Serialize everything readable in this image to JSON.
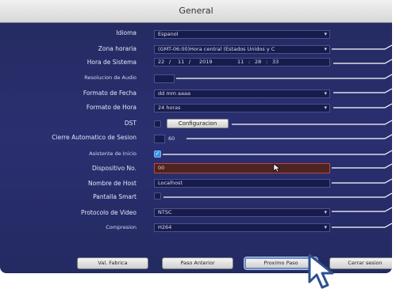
{
  "title": "General",
  "settings": [
    {
      "label": "Idioma",
      "value": "Espanol",
      "type": "dropdown"
    },
    {
      "label": "Zona horaria",
      "value": "(GMT-06:00)Hora central (Estados Unidos y C",
      "type": "dropdown"
    },
    {
      "label": "Hora de Sistema",
      "type": "datetime"
    },
    {
      "label": "Resolucion de Audio",
      "type": "small"
    },
    {
      "label": "Formato de Fecha",
      "value": "dd mm aaaa",
      "type": "dropdown"
    },
    {
      "label": "Formato de Hora",
      "value": "24 horas",
      "type": "dropdown"
    },
    {
      "label": "DST",
      "type": "dst"
    },
    {
      "label": "Cierre Automatico de Sesion",
      "value": "60",
      "type": "small-value"
    },
    {
      "label": "Asistente de Inicio",
      "type": "checkbox-on"
    },
    {
      "label": "Dispositivo No.",
      "value": "00",
      "type": "highlighted"
    },
    {
      "label": "Nombre de Host",
      "value": "Localhost",
      "type": "text"
    },
    {
      "label": "Pantalla Smart",
      "type": "checkbox-off"
    },
    {
      "label": "Protocolo de Video",
      "value": "NTSC",
      "type": "dropdown"
    },
    {
      "label": "Compresion",
      "value": "H264",
      "type": "dropdown"
    }
  ],
  "datetime": {
    "day": "22",
    "month": "11",
    "year": "2019",
    "hour": "11",
    "minute": "28",
    "second": "33",
    "sep_date": "/",
    "sep_time": ":"
  },
  "dst_button": "Configuracion",
  "checkmark": "✓",
  "footer": {
    "btn1": "Val. Fabrica",
    "btn2": "Paso Anterior",
    "btn3": "Proximo Paso",
    "btn4": "Cerrar sesion"
  },
  "icons": [
    "dropdown-arrow-icon",
    "checkbox-icon",
    "mouse-pointer-icon",
    "hand-cursor-icon"
  ],
  "colors": {
    "panel": "#262b66",
    "titlebar": "#e4e4e4",
    "highlight_border": "#c2443a",
    "leader_line": "#ffffff"
  }
}
